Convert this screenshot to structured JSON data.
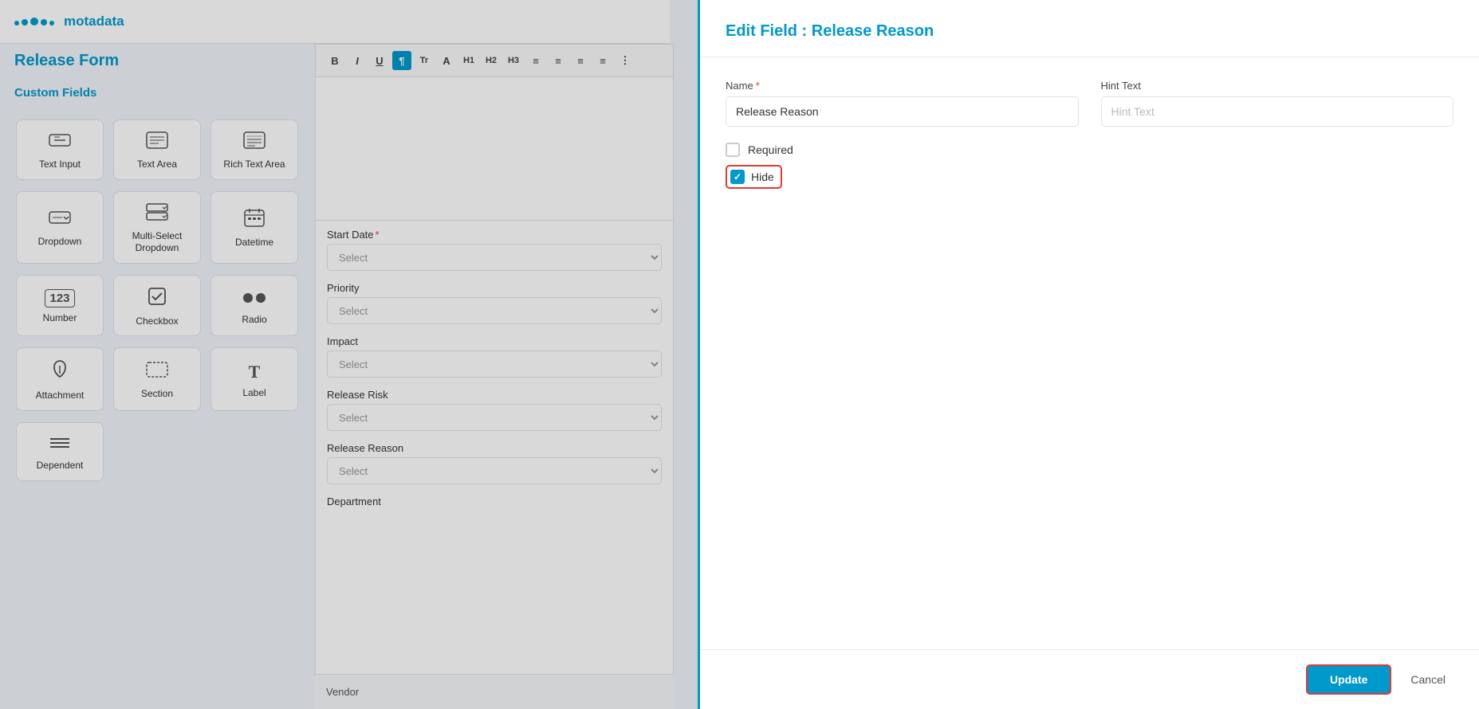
{
  "app": {
    "name": "motadata",
    "page_title": "Release Form",
    "custom_fields_title": "Custom Fields"
  },
  "toolbar": {
    "buttons": [
      "B",
      "I",
      "U",
      "¶",
      "Tr",
      "A",
      "H1",
      "H2",
      "H3",
      "≡",
      "≡",
      "≡",
      "≡",
      "⋮⋮⋮"
    ]
  },
  "field_palette": [
    {
      "id": "text-input",
      "label": "Text Input",
      "icon": "⇄"
    },
    {
      "id": "text-area",
      "label": "Text Area",
      "icon": "⇄"
    },
    {
      "id": "rich-text-area",
      "label": "Rich Text Area",
      "icon": "⇄"
    },
    {
      "id": "dropdown",
      "label": "Dropdown",
      "icon": "☰"
    },
    {
      "id": "multi-select-dropdown",
      "label": "Multi-Select Dropdown",
      "icon": "☰"
    },
    {
      "id": "datetime",
      "label": "Datetime",
      "icon": "📅"
    },
    {
      "id": "number",
      "label": "Number",
      "icon": "123"
    },
    {
      "id": "checkbox",
      "label": "Checkbox",
      "icon": "☑"
    },
    {
      "id": "radio",
      "label": "Radio",
      "icon": "⬤⬤"
    },
    {
      "id": "attachment",
      "label": "Attachment",
      "icon": "📎"
    },
    {
      "id": "section",
      "label": "Section",
      "icon": "▭"
    },
    {
      "id": "label",
      "label": "Label",
      "icon": "T"
    },
    {
      "id": "dependent",
      "label": "Dependent",
      "icon": "≡"
    }
  ],
  "form_fields": [
    {
      "label": "Start Date",
      "required": true,
      "placeholder": "Select"
    },
    {
      "label": "Priority",
      "required": false,
      "placeholder": "Select"
    },
    {
      "label": "Impact",
      "required": false,
      "placeholder": "Select"
    },
    {
      "label": "Release Risk",
      "required": false,
      "placeholder": "Select"
    },
    {
      "label": "Release Reason",
      "required": false,
      "placeholder": "Select"
    },
    {
      "label": "Department",
      "required": false,
      "placeholder": ""
    }
  ],
  "modal": {
    "title": "Edit Field : Release Reason",
    "name_label": "Name",
    "name_required": true,
    "name_value": "Release Reason",
    "hint_text_label": "Hint Text",
    "hint_text_placeholder": "Hint Text",
    "required_label": "Required",
    "required_checked": false,
    "hide_label": "Hide",
    "hide_checked": true,
    "update_btn": "Update",
    "cancel_btn": "Cancel"
  },
  "bottom_bar": {
    "left_label": "Vendor"
  }
}
